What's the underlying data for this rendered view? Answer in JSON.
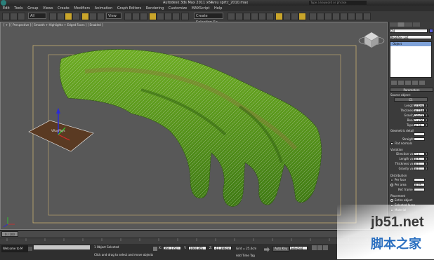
{
  "title_bar": {
    "app_title": "Autodesk 3ds Max  2011 x64",
    "file_name": "cvsu sprtc_2010.max",
    "search_placeholder": "Type a keyword or phrase"
  },
  "menu": [
    "Edit",
    "Tools",
    "Group",
    "Views",
    "Create",
    "Modifiers",
    "Animation",
    "Graph Editors",
    "Rendering",
    "Customize",
    "MAXScript",
    "Help"
  ],
  "toolbar": {
    "filter_value": "All",
    "view_value": "View",
    "selection_set_placeholder": "Create Selection Se"
  },
  "viewport": {
    "label": "[ + ] [ Perspective ] [ Smooth + Highlights + Edged Faces ] [ Enabled ]",
    "gizmo_label": "VRayPhys"
  },
  "command_panel": {
    "object_name": "Z4",
    "modifier_list": "Modifier List",
    "stack_item": "Object",
    "rollout_parameters": "Parameters",
    "source_object_label": "Source object:",
    "source_object_value": "C1",
    "params": [
      {
        "label": "Length",
        "value": "4.0cm"
      },
      {
        "label": "Thickness",
        "value": "0.114cm"
      },
      {
        "label": "Gravity",
        "value": "10.033cm"
      },
      {
        "label": "Bend",
        "value": "1.426"
      },
      {
        "label": "Taper",
        "value": "0.58"
      }
    ],
    "geometric_detail_label": "Geometric detail",
    "straight_label": "Straight",
    "flat_normals_label": "Flat normals",
    "variation_label": "Variation",
    "variation": [
      {
        "label": "Direction var",
        "value": "1.4"
      },
      {
        "label": "Length var",
        "value": "0.5"
      },
      {
        "label": "Thickness var",
        "value": "0.2"
      },
      {
        "label": "Gravity var",
        "value": "0.2"
      }
    ],
    "distribution_label": "Distribution",
    "per_face_label": "Per face",
    "per_area_label": "Per area",
    "per_area_value": "0.15",
    "ref_frame_label": "Ref. frame",
    "placement_label": "Placement",
    "entire_object_label": "Entire object",
    "selected_faces_label": "Selected faces",
    "material_label": "Material"
  },
  "bottom": {
    "frame_counter": "0 / 100",
    "welcome": "Welcome to M",
    "status_selected": "1 Object Selected",
    "status_hint": "Click and drag to select and move objects",
    "x_value": "264.135cr",
    "y_value": "1064.365",
    "z_value": "-11.396cm",
    "grid_value": "Grid = 25.4cm",
    "auto_key": "Auto Key",
    "add_time_tag": "Add Time Tag",
    "selected_dropdown": "Selected"
  },
  "watermark": {
    "site": "jb51.net",
    "brand": "脚本之家"
  },
  "colors": {
    "viewport_bg": "#585858",
    "grass": "#5c9a1e",
    "safe_frame": "#c8b070",
    "gizmo": "#5a3a22"
  }
}
